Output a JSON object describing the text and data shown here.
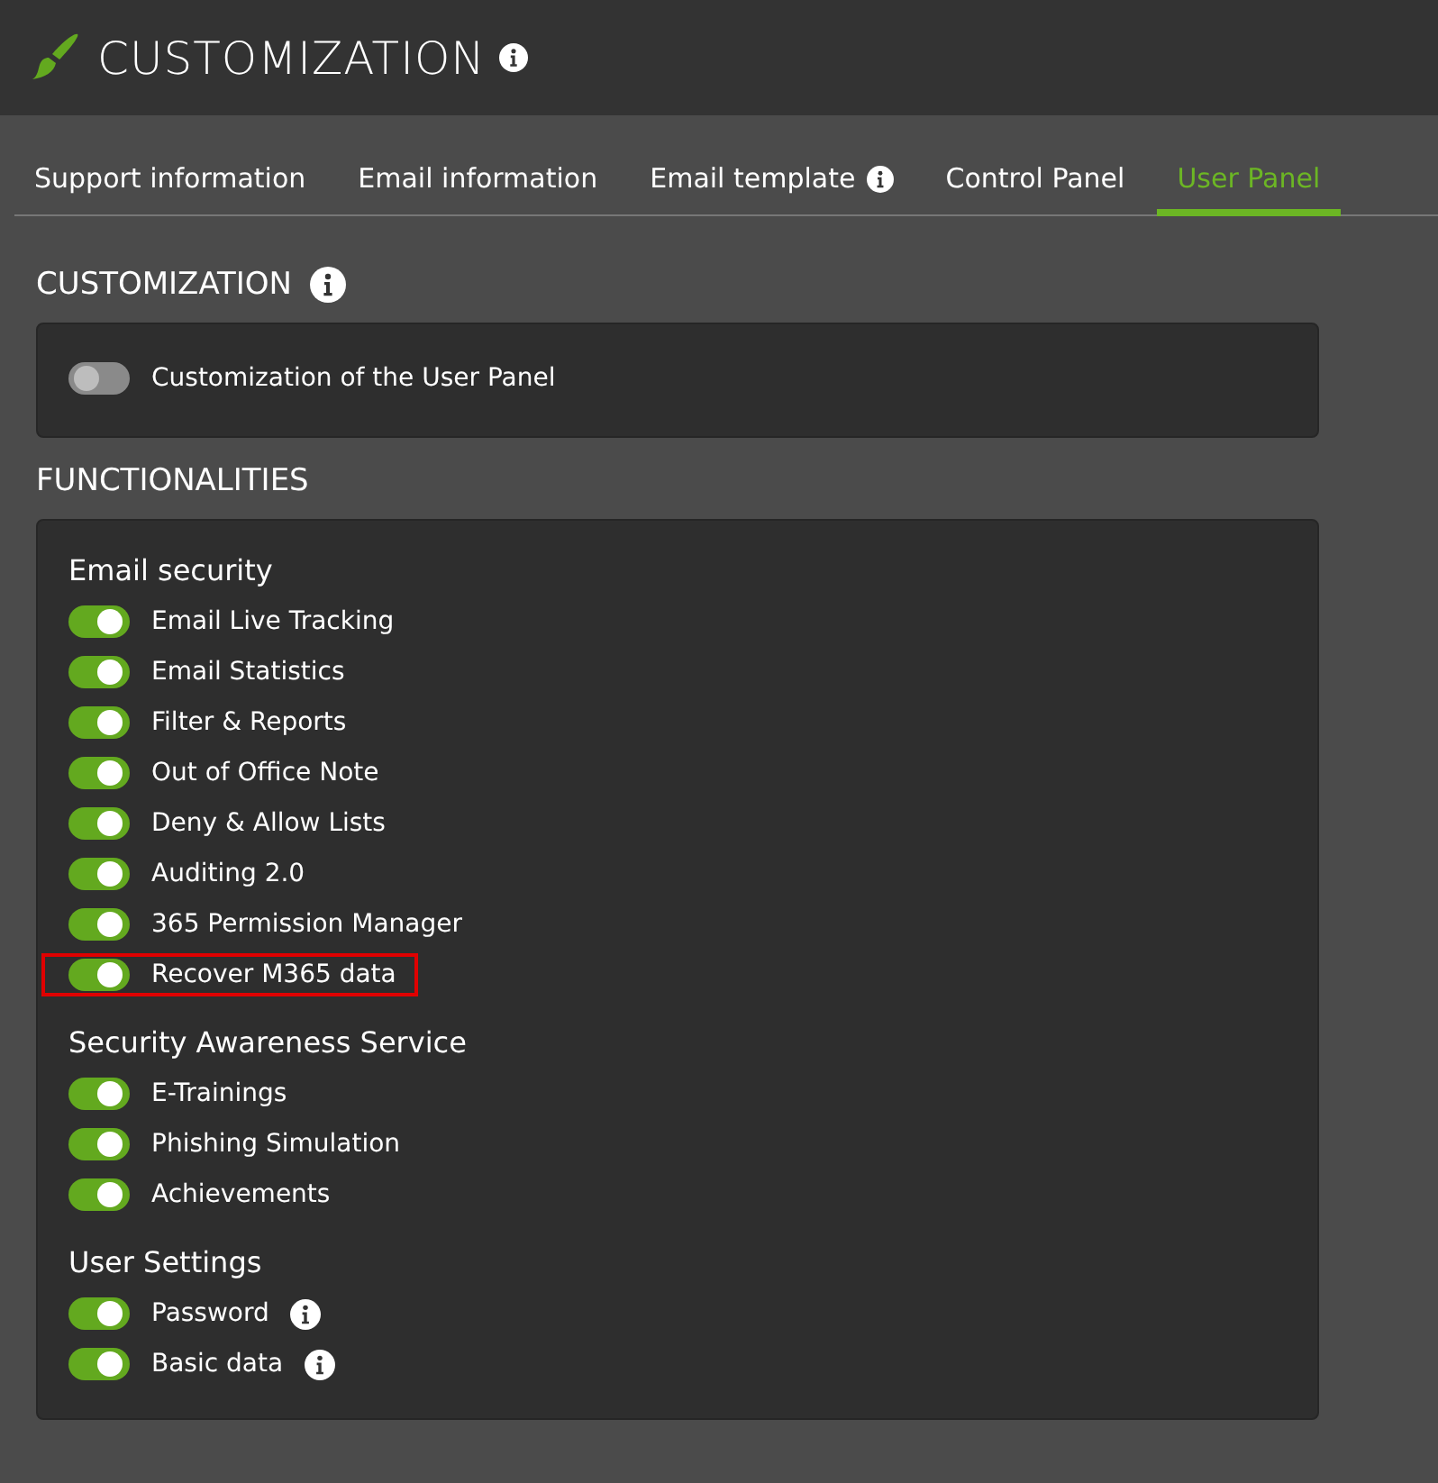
{
  "header": {
    "title": "CUSTOMIZATION"
  },
  "tabs": [
    {
      "label": "Support information",
      "selected": false,
      "info": false
    },
    {
      "label": "Email information",
      "selected": false,
      "info": false
    },
    {
      "label": "Email template",
      "selected": false,
      "info": true
    },
    {
      "label": "Control Panel",
      "selected": false,
      "info": false
    },
    {
      "label": "User Panel",
      "selected": true,
      "info": false
    }
  ],
  "customization": {
    "title": "CUSTOMIZATION",
    "toggle": {
      "label": "Customization of the User Panel",
      "on": false
    }
  },
  "functionalities": {
    "title": "FUNCTIONALITIES",
    "groups": [
      {
        "title": "Email security",
        "items": [
          {
            "label": "Email Live Tracking",
            "on": true,
            "info": false,
            "highlighted": false
          },
          {
            "label": "Email Statistics",
            "on": true,
            "info": false,
            "highlighted": false
          },
          {
            "label": "Filter & Reports",
            "on": true,
            "info": false,
            "highlighted": false
          },
          {
            "label": "Out of Office Note",
            "on": true,
            "info": false,
            "highlighted": false
          },
          {
            "label": "Deny & Allow Lists",
            "on": true,
            "info": false,
            "highlighted": false
          },
          {
            "label": "Auditing 2.0",
            "on": true,
            "info": false,
            "highlighted": false
          },
          {
            "label": "365 Permission Manager",
            "on": true,
            "info": false,
            "highlighted": false
          },
          {
            "label": "Recover M365 data",
            "on": true,
            "info": false,
            "highlighted": true
          }
        ]
      },
      {
        "title": "Security Awareness Service",
        "items": [
          {
            "label": "E-Trainings",
            "on": true,
            "info": false,
            "highlighted": false
          },
          {
            "label": "Phishing Simulation",
            "on": true,
            "info": false,
            "highlighted": false
          },
          {
            "label": "Achievements",
            "on": true,
            "info": false,
            "highlighted": false
          }
        ]
      },
      {
        "title": "User Settings",
        "items": [
          {
            "label": "Password",
            "on": true,
            "info": true,
            "highlighted": false
          },
          {
            "label": "Basic data",
            "on": true,
            "info": true,
            "highlighted": false
          }
        ]
      }
    ]
  }
}
